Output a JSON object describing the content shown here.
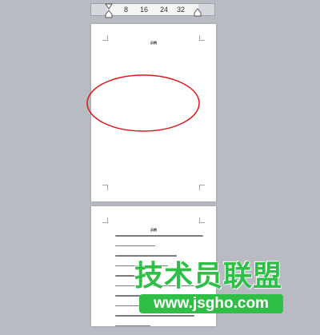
{
  "ruler": {
    "ticks": [
      "8",
      "16",
      "24",
      "32"
    ]
  },
  "page1": {
    "title": "示例"
  },
  "page2": {
    "title": "示例"
  },
  "watermark": {
    "title": "技术员联盟",
    "url": "www.jsgho.com"
  },
  "colors": {
    "background": "#b9bbc3",
    "page": "#ffffff",
    "ellipse_stroke": "#e0161b",
    "watermark_green": "#2fbf47"
  }
}
